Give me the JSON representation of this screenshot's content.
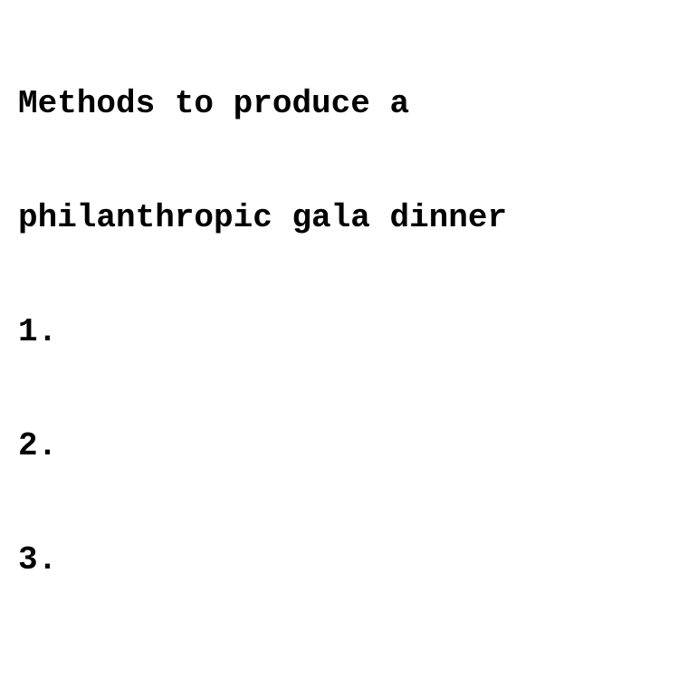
{
  "document": {
    "title_line_1": "Methods to produce a",
    "title_line_2": "philanthropic gala dinner",
    "items": [
      "1.",
      "2.",
      "3."
    ]
  }
}
